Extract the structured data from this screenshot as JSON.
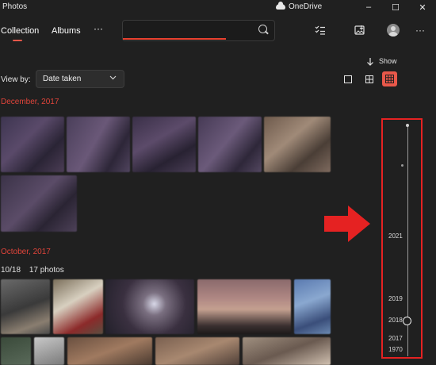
{
  "app": {
    "title": "Photos",
    "onedrive_label": "OneDrive"
  },
  "window_controls": {
    "minimize": "–",
    "maximize": "☐",
    "close": "✕"
  },
  "toolbar": {
    "tabs": [
      {
        "label": "Collection",
        "active": true
      },
      {
        "label": "Albums",
        "active": false
      }
    ],
    "more_label": "···",
    "search": {
      "value": "",
      "placeholder": ""
    },
    "right_more_label": "···"
  },
  "view": {
    "show_label": "Show",
    "view_by_label": "View by:",
    "view_by_value": "Date taken",
    "active_view_color": "#e8584a"
  },
  "sections": [
    {
      "title": "December, 2017"
    },
    {
      "title": "October, 2017",
      "subheader": {
        "date": "10/18",
        "count": "17 photos"
      }
    }
  ],
  "timeline": {
    "labels": [
      "2021",
      "2019",
      "2018",
      "2017",
      "1970"
    ],
    "current_year": "2018",
    "highlight_color": "#e52222"
  },
  "annotation": {
    "arrow_color": "#e52222"
  }
}
